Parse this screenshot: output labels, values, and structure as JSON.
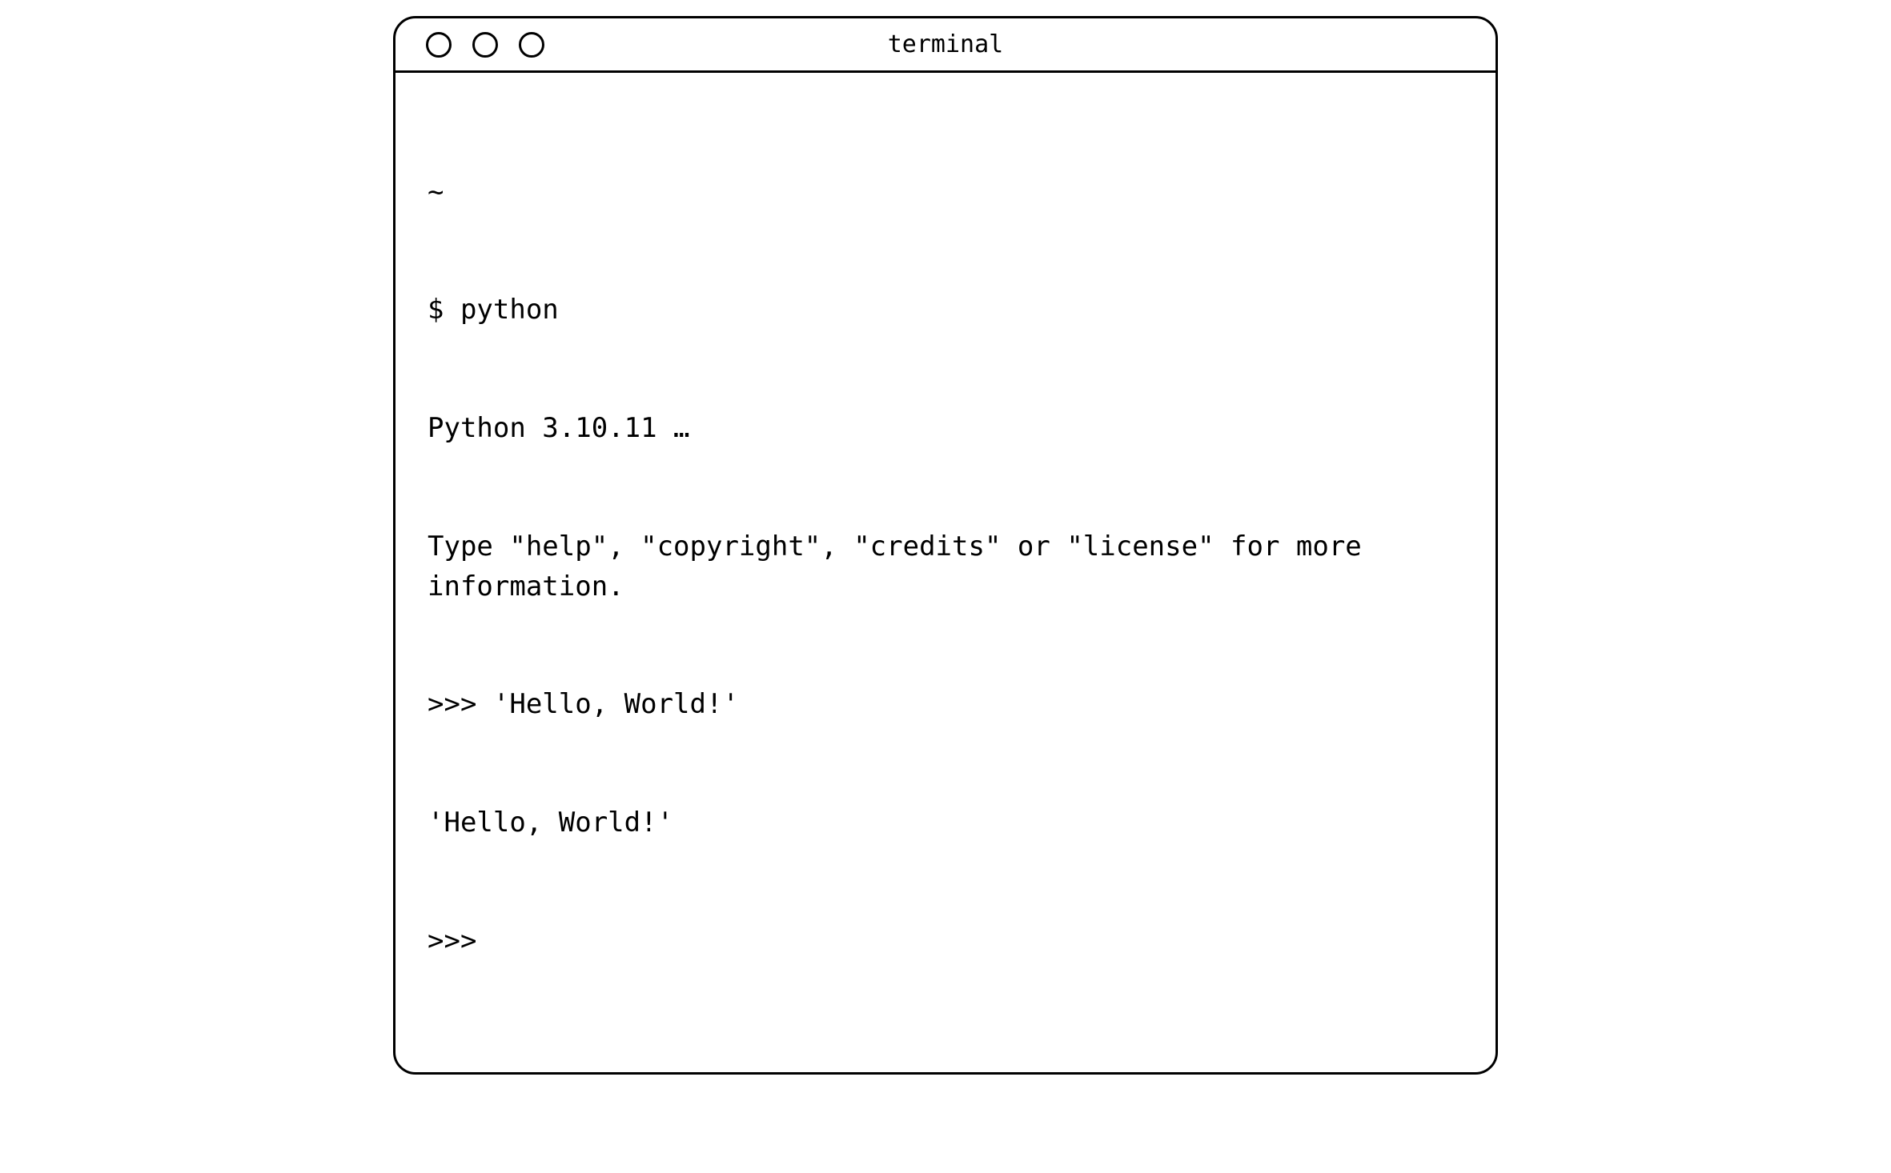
{
  "window": {
    "title": "terminal"
  },
  "terminal": {
    "lines": [
      "~",
      "$ python",
      "Python 3.10.11 …",
      "Type \"help\", \"copyright\", \"credits\" or \"license\" for more information.",
      ">>> 'Hello, World!'",
      "'Hello, World!'",
      ">>>"
    ]
  }
}
